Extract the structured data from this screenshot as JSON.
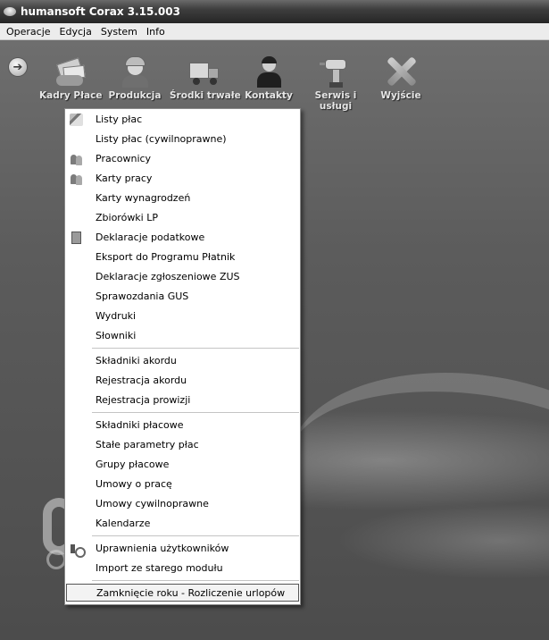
{
  "window": {
    "title": "humansoft Corax 3.15.003"
  },
  "menubar": {
    "items": [
      "Operacje",
      "Edycja",
      "System",
      "Info"
    ]
  },
  "toolbar": {
    "back_icon": "back-arrow-icon",
    "buttons": [
      {
        "label": "Kadry Płace",
        "icon": "money-hands-icon"
      },
      {
        "label": "Produkcja",
        "icon": "worker-icon"
      },
      {
        "label": "Środki trwałe",
        "icon": "truck-icon"
      },
      {
        "label": "Kontakty",
        "icon": "person-icon"
      },
      {
        "label": "Serwis i",
        "label2": "usługi",
        "icon": "drill-icon"
      },
      {
        "label": "Wyjście",
        "icon": "exit-x-icon"
      }
    ]
  },
  "dropdown": {
    "groups": [
      [
        "Listy płac",
        "Listy płac (cywilnoprawne)",
        "Pracownicy",
        "Karty pracy",
        "Karty wynagrodzeń",
        "Zbiorówki LP",
        "Deklaracje podatkowe",
        "Eksport do Programu Płatnik",
        "Deklaracje zgłoszeniowe ZUS",
        "Sprawozdania GUS",
        "Wydruki",
        "Słowniki"
      ],
      [
        "Składniki akordu",
        "Rejestracja akordu",
        "Rejestracja prowizji"
      ],
      [
        "Składniki płacowe",
        "Stałe parametry płac",
        "Grupy płacowe",
        "Umowy o pracę",
        "Umowy cywilnoprawne",
        "Kalendarze"
      ],
      [
        "Uprawnienia użytkowników",
        "Import ze starego modułu"
      ],
      [
        "Zamknięcie roku - Rozliczenie urlopów"
      ]
    ],
    "selected_item": "Zamknięcie roku - Rozliczenie urlopów"
  }
}
